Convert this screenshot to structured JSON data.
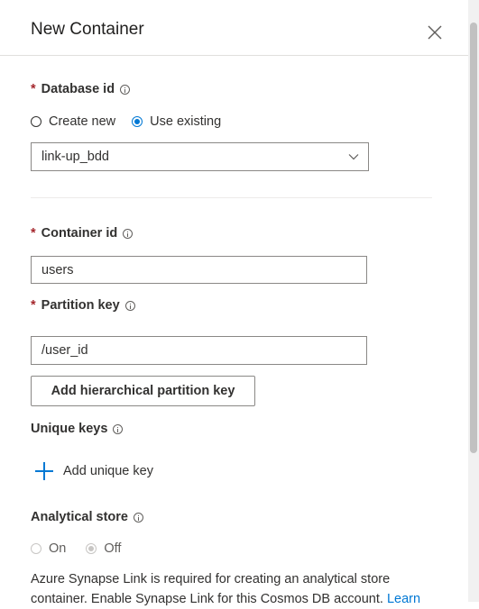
{
  "header": {
    "title": "New Container"
  },
  "database": {
    "label": "Database id",
    "required_mark": "*",
    "options": [
      "Create new",
      "Use existing"
    ],
    "selected_option": "Use existing",
    "selected_value": "link-up_bdd"
  },
  "container": {
    "label": "Container id",
    "required_mark": "*",
    "value": "users"
  },
  "partition": {
    "label": "Partition key",
    "required_mark": "*",
    "value": "/user_id",
    "hier_button": "Add hierarchical partition key"
  },
  "unique_keys": {
    "label": "Unique keys",
    "add_label": "Add unique key"
  },
  "analytical": {
    "label": "Analytical store",
    "options": [
      "On",
      "Off"
    ],
    "selected_option": "Off",
    "description": "Azure Synapse Link is required for creating an analytical store container. Enable Synapse Link for this Cosmos DB account.",
    "link_text": "Learn"
  },
  "colors": {
    "accent": "#0078d4",
    "required": "#a4262c"
  },
  "icons": {
    "close": "close-icon",
    "info": "info-icon",
    "chevron": "chevron-down-icon",
    "add": "plus-icon"
  }
}
